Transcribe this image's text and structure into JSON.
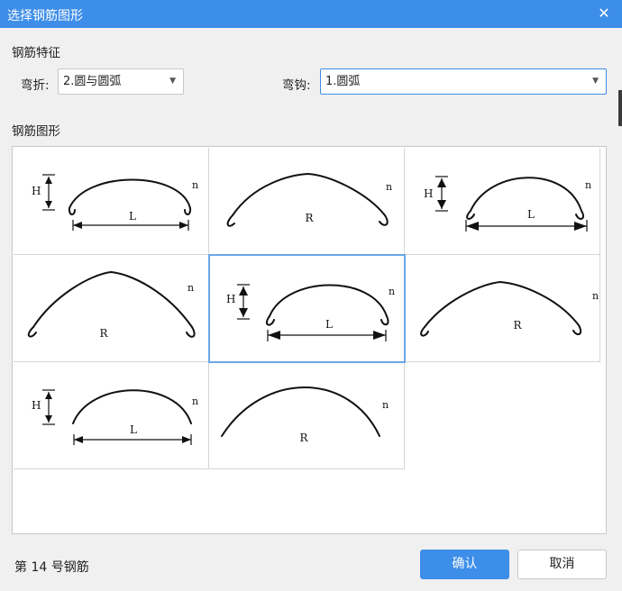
{
  "window": {
    "title": "选择钢筋图形"
  },
  "features": {
    "section_label": "钢筋特征",
    "bend_label": "弯折:",
    "bend_value": "2.圆与圆弧",
    "hook_label": "弯钩:",
    "hook_value": "1.圆弧"
  },
  "shapes": {
    "section_label": "钢筋图形",
    "items": [
      {
        "labels": {
          "h": "H",
          "main": "L",
          "n": "n"
        }
      },
      {
        "labels": {
          "main": "R",
          "n": "n"
        }
      },
      {
        "labels": {
          "h": "H",
          "main": "L",
          "n": "n"
        }
      },
      {
        "labels": {
          "main": "R",
          "n": "n"
        }
      },
      {
        "labels": {
          "h": "H",
          "main": "L",
          "n": "n"
        }
      },
      {
        "labels": {
          "main": "R",
          "n": "n"
        }
      },
      {
        "labels": {
          "h": "H",
          "main": "L",
          "n": "n"
        }
      },
      {
        "labels": {
          "main": "R",
          "n": "n"
        }
      }
    ],
    "selected_index": 4
  },
  "footer": {
    "status": "第 14 号钢筋",
    "confirm_label": "确认",
    "cancel_label": "取消"
  },
  "colors": {
    "accent": "#3d8ee8",
    "selected_border": "#6aa8e8"
  }
}
